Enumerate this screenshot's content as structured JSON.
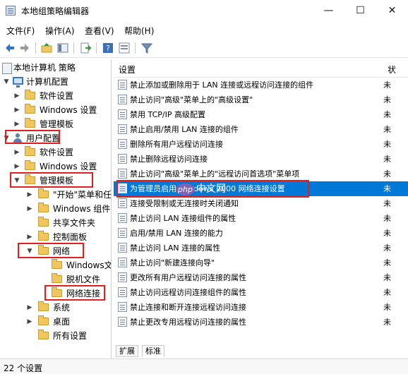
{
  "window": {
    "title": "本地组策略编辑器",
    "minimize_glyph": "—",
    "maximize_glyph": "☐",
    "close_glyph": "✕"
  },
  "menu": [
    "文件(F)",
    "操作(A)",
    "查看(V)",
    "帮助(H)"
  ],
  "toolbar": {
    "icons": [
      "back-arrow-icon",
      "forward-arrow-icon",
      "up-folder-icon",
      "show-hide-tree-icon",
      "export-list-icon",
      "help-icon",
      "properties-icon",
      "filter-icon"
    ]
  },
  "tree": {
    "root": "本地计算机 策略",
    "computer_config": "计算机配置",
    "cc_software": "软件设置",
    "cc_windows": "Windows 设置",
    "cc_admin": "管理模板",
    "user_config": "用户配置",
    "uc_software": "软件设置",
    "uc_windows": "Windows 设置",
    "uc_admin": "管理模板",
    "start_menu": "\"开始\"菜单和任",
    "windows_components": "Windows 组件",
    "shared_folders": "共享文件夹",
    "control_panel": "控制面板",
    "network": "网络",
    "windows_file": "Windows文",
    "offline_files": "脱机文件",
    "network_connections": "网络连接",
    "system": "系统",
    "desktop": "桌面",
    "all_settings": "所有设置"
  },
  "list": {
    "header_setting": "设置",
    "header_state": "状",
    "rows": [
      {
        "name": "禁止添加或删除用于 LAN 连接或远程访问连接的组件",
        "state": "未"
      },
      {
        "name": "禁止访问\"高级\"菜单上的\"高级设置\"",
        "state": "未"
      },
      {
        "name": "禁用 TCP/IP 高级配置",
        "state": "未"
      },
      {
        "name": "禁止启用/禁用 LAN 连接的组件",
        "state": "未"
      },
      {
        "name": "删除所有用户远程访问连接",
        "state": "未"
      },
      {
        "name": "禁止删除远程访问连接",
        "state": "未"
      },
      {
        "name": "禁止访问\"高级\"菜单上的\"远程访问首选项\"菜单项",
        "state": "未"
      },
      {
        "name": "为管理员启用 Windows 2000 网络连接设置",
        "state": "未"
      },
      {
        "name": "连接受限制或无连接时关闭通知",
        "state": "未"
      },
      {
        "name": "禁止访问 LAN 连接组件的属性",
        "state": "未"
      },
      {
        "name": "启用/禁用 LAN 连接的能力",
        "state": "未"
      },
      {
        "name": "禁止访问 LAN 连接的属性",
        "state": "未"
      },
      {
        "name": "禁止访问\"新建连接向导\"",
        "state": "未"
      },
      {
        "name": "更改所有用户远程访问连接的属性",
        "state": "未"
      },
      {
        "name": "禁止访问远程访问连接组件的属性",
        "state": "未"
      },
      {
        "name": "禁止连接和断开连接远程访问连接",
        "state": "未"
      },
      {
        "name": "禁止更改专用远程访问连接的属性",
        "state": "未"
      }
    ]
  },
  "tabs": [
    "扩展",
    "标准"
  ],
  "status": "22 个设置",
  "watermark": {
    "logo": "php",
    "text": "中文网"
  },
  "colors": {
    "selection": "#0078d7",
    "highlight_box": "#e0201e",
    "folder": "#f0c75e"
  }
}
